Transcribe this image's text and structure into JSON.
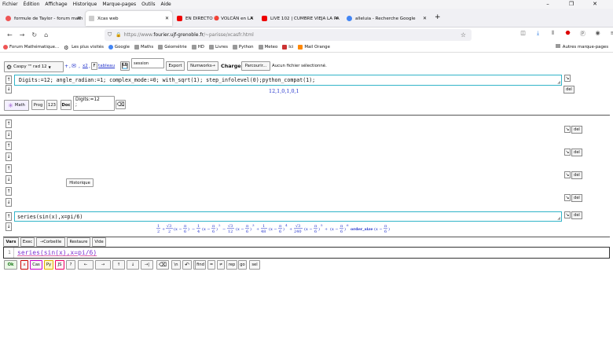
{
  "menubar": [
    "Fichier",
    "Édition",
    "Affichage",
    "Historique",
    "Marque-pages",
    "Outils",
    "Aide"
  ],
  "tabs": [
    {
      "label": "formule de Taylor - forum math",
      "color": "#e55"
    },
    {
      "label": "Xcas web",
      "color": "#ccc"
    },
    {
      "label": "EN DIRECTO 🔴 VOLCÁN en LA",
      "color": "#e00"
    },
    {
      "label": "LIVE 102 | CUMBRE VIEJA LA PA",
      "color": "#e00"
    },
    {
      "label": "alleluia - Recherche Google",
      "color": "#4285f4"
    }
  ],
  "url": {
    "prefix": "https://www.",
    "domain": "fourier.ujf-grenoble.fr",
    "suffix": "/~parisse/xcasfr.html"
  },
  "bookmarks": [
    "Forum Mathématique...",
    "Les plus visités",
    "Google",
    "Maths",
    "Géométrie",
    "HD",
    "Livres",
    "Python",
    "Meteo",
    "Ici",
    "Mail Orange"
  ],
  "bookmarks_other": "Autres marque-pages",
  "toolbar": {
    "caspy": "Caspy \"\" rad 12",
    "plus": "+",
    "envelope": "✉",
    "x2": "x2",
    "f": "F",
    "tableau": "tableau",
    "session": "session",
    "export": "Export",
    "numworks": "Numworks→",
    "charger": "Charger",
    "parcourir": "Parcourir...",
    "aucun": "Aucun fichier sélectionné."
  },
  "cell1": {
    "input": "Digits:=12; angle_radian:=1; complex_mode:=0; with_sqrt(1); step_infolevel(0);python_compat(1);",
    "output": "12,1,0,1,0,1"
  },
  "mode_tabs": [
    "Math",
    "Prog",
    "123",
    "Doc"
  ],
  "digits_box": "Digits:=12\n;",
  "historique": "Historique",
  "cell2": {
    "input": "series(sin(x),x=pi/6)"
  },
  "del_label": "del",
  "bottom_tabs": [
    "Vars",
    "Exec",
    "→Corbeille",
    "Restaure",
    "Vide"
  ],
  "editor": {
    "line": "1",
    "text": "series(sin(x),x=pi/6)"
  },
  "keys": [
    "Ok",
    "x",
    "Cas",
    "Py",
    "JS",
    "?",
    "←",
    "→",
    "↑",
    "↓",
    "→|",
    "⌫",
    "\\n",
    "↶",
    "↷",
    "find",
    "=",
    "≠",
    "rep",
    "go",
    "sel"
  ]
}
